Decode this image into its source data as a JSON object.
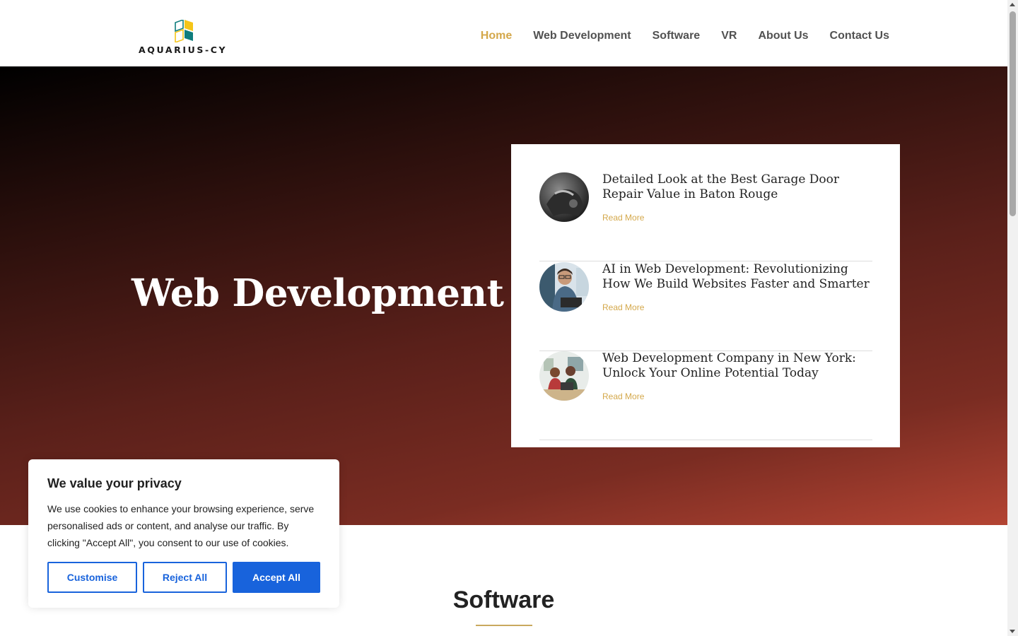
{
  "brand": {
    "name": "AQUARIUS-CY",
    "colors": {
      "accent": "#d4a84b",
      "teal": "#0f7d7d",
      "yellow": "#f5c518",
      "blue": "#1863dc"
    }
  },
  "nav": {
    "items": [
      {
        "label": "Home",
        "active": true
      },
      {
        "label": "Web Development",
        "active": false
      },
      {
        "label": "Software",
        "active": false
      },
      {
        "label": "VR",
        "active": false
      },
      {
        "label": "About Us",
        "active": false
      },
      {
        "label": "Contact Us",
        "active": false
      }
    ]
  },
  "hero": {
    "title": "Web Development",
    "posts": [
      {
        "title": "Detailed Look at the Best Garage Door Repair Value in Baton Rouge",
        "link": "Read More",
        "thumb_icon": "garage-door-photo"
      },
      {
        "title": "AI in Web Development: Revolutionizing How We Build Websites Faster and Smarter",
        "link": "Read More",
        "thumb_icon": "developer-laptop-photo"
      },
      {
        "title": "Web Development Company in New York: Unlock Your Online Potential Today",
        "link": "Read More",
        "thumb_icon": "team-office-photo"
      }
    ]
  },
  "software": {
    "title": "Software"
  },
  "cookie": {
    "title": "We value your privacy",
    "text": "We use cookies to enhance your browsing experience, serve personalised ads or content, and analyse our traffic. By clicking \"Accept All\", you consent to our use of cookies.",
    "customise": "Customise",
    "reject": "Reject All",
    "accept": "Accept All"
  }
}
